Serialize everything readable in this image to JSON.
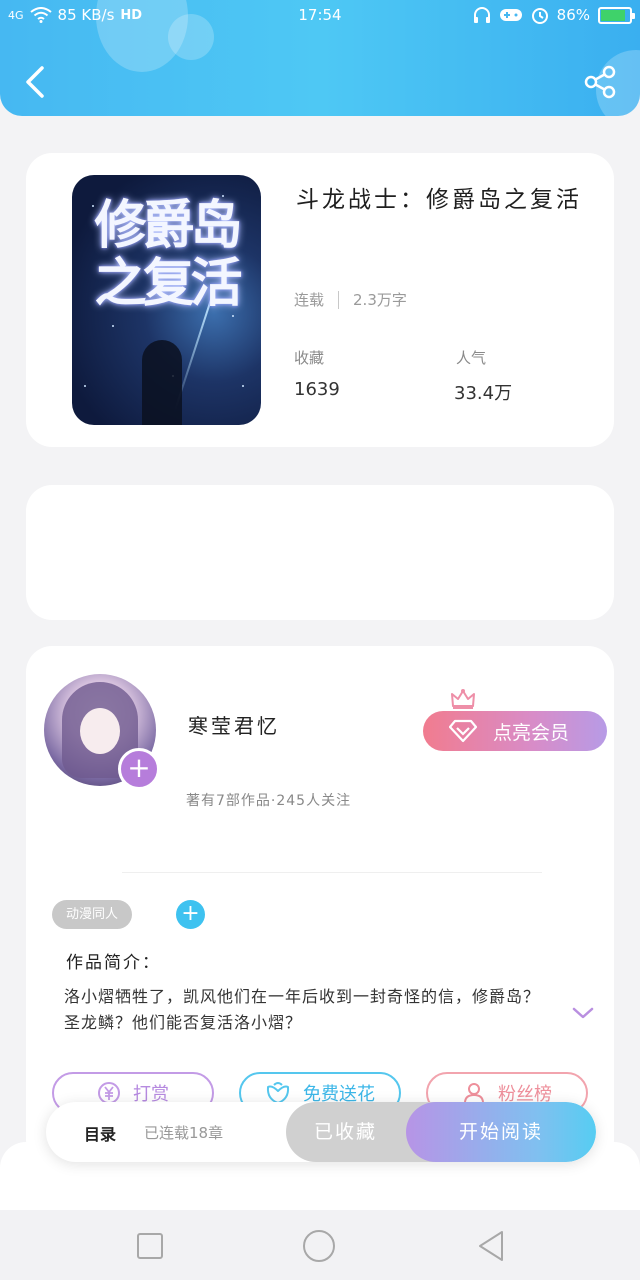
{
  "statusbar": {
    "network": "4G",
    "speed": "85 KB/s",
    "hd": "HD",
    "time": "17:54",
    "battery": "86%",
    "battery_level": 0.86
  },
  "header": {
    "back_icon": "chevron-left-icon",
    "share_icon": "share-icon",
    "bg_color": "#46b8f2"
  },
  "book": {
    "cover_title": "修爵岛之复活",
    "title": "斗龙战士：修爵岛之复活",
    "status": "连载",
    "word_count": "2.3万字",
    "favorites_label": "收藏",
    "favorites_value": "1639",
    "popularity_label": "人气",
    "popularity_value": "33.4万"
  },
  "author": {
    "name": "寒莹君忆",
    "stats": "著有7部作品·245人关注",
    "follow_icon": "plus-icon",
    "vip_label": "点亮会员",
    "vip_icon": "diamond-icon",
    "crown_icon": "crown-icon"
  },
  "tags": {
    "items": [
      "动漫同人"
    ],
    "add_icon": "plus-icon"
  },
  "intro": {
    "heading": "作品简介：",
    "text": "洛小熠牺牲了，凯风他们在一年后收到一封奇怪的信，修爵岛？圣龙鳞？他们能否复活洛小熠？",
    "expand_icon": "chevron-down-icon"
  },
  "actions": {
    "reward_label": "打赏",
    "reward_icon": "yen-coin-icon",
    "flower_label": "免费送花",
    "flower_icon": "flower-icon",
    "fans_label": "粉丝榜",
    "fans_icon": "user-icon"
  },
  "bottom_bar": {
    "toc_label": "目录",
    "toc_status": "已连载18章",
    "collected_label": "已收藏",
    "read_label": "开始阅读"
  },
  "navbar": {
    "recent_icon": "square-icon",
    "home_icon": "circle-icon",
    "back_icon": "triangle-back-icon"
  }
}
